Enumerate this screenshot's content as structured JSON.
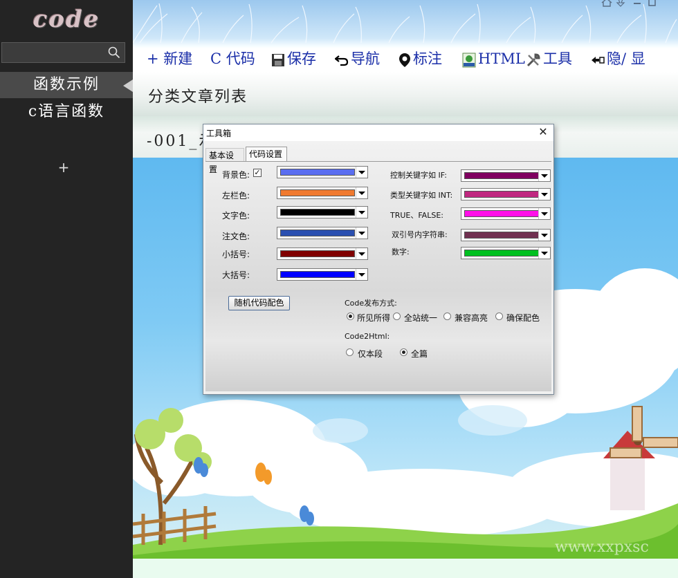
{
  "window": {
    "controls": [
      "home-icon",
      "pin-icon",
      "minimize-icon",
      "maximize-icon"
    ]
  },
  "sidebar": {
    "logo": "code",
    "search": {
      "placeholder": ""
    },
    "items": [
      {
        "label": "函数示例",
        "active": true
      },
      {
        "label": "c语言函数",
        "active": false
      }
    ],
    "add_label": "+"
  },
  "toolbar": {
    "new_label": "+ 新建",
    "code_label": "C 代码",
    "save_label": "保存",
    "nav_label": "导航",
    "mark_label": "标注",
    "html_label": "HTML",
    "tools_label": "工具",
    "toggle_label": "隐/ 显"
  },
  "page": {
    "title": "分类文章列表",
    "article_title": "-001_示"
  },
  "dialog": {
    "title": "工具箱",
    "tabs": [
      {
        "label": "基本设置",
        "active": false
      },
      {
        "label": "代码设置",
        "active": true
      }
    ],
    "left_colors": [
      {
        "label": "背景色:",
        "color": "#5a6ef0"
      },
      {
        "label": "左栏色:",
        "color": "#f07a30"
      },
      {
        "label": "文字色:",
        "color": "#000000"
      },
      {
        "label": "注文色:",
        "color": "#2a4fb0"
      },
      {
        "label": "小括号:",
        "color": "#800000"
      },
      {
        "label": "大括号:",
        "color": "#0000ff"
      }
    ],
    "bg_checkbox_checked": true,
    "right_colors": [
      {
        "label": "控制关键字如 IF:",
        "color": "#800060"
      },
      {
        "label": "类型关键字如 INT:",
        "color": "#c02880"
      },
      {
        "label": "TRUE、FALSE:",
        "color": "#ff10e8"
      },
      {
        "label": "双引号内字符串:",
        "color": "#703050"
      },
      {
        "label": "数字:",
        "color": "#00c020"
      }
    ],
    "random_button": "随机代码配色",
    "publish": {
      "label": "Code发布方式:",
      "options": [
        "所见所得",
        "全站统一",
        "兼容高亮",
        "确保配色"
      ],
      "selected": 0
    },
    "code2html": {
      "label": "Code2Html:",
      "options": [
        "仅本段",
        "全篇"
      ],
      "selected": 1
    }
  },
  "watermark": "www.xxpxsc"
}
